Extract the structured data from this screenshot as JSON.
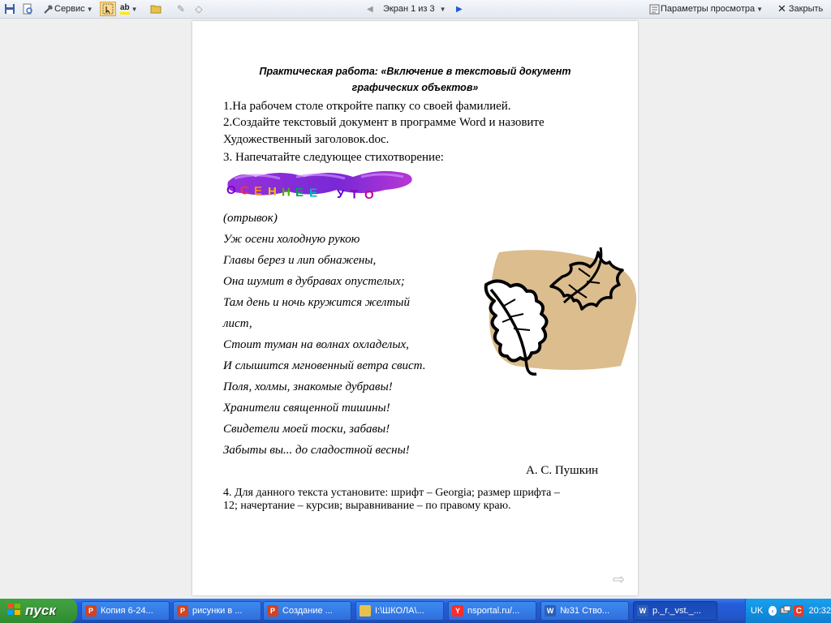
{
  "toolbar": {
    "service_label": "Сервис",
    "screen_label": "Экран 1 из 3",
    "view_params_label": "Параметры просмотра",
    "close_label": "Закрыть",
    "highlight_glyph": "ab"
  },
  "document": {
    "title_line1": "Практическая работа: «Включение в текстовый документ",
    "title_line2": "графических объектов»",
    "step1": "1.На рабочем столе откройте папку со своей фамилией.",
    "step2_line1": "2.Создайте текстовый документ в программе Word и назовите",
    "step2_line2": "Художественный заголовок.doc.",
    "step3": "3. Напечатайте следующее стихотворение:",
    "wordart_letters": [
      "О",
      "С",
      "Е",
      "Н",
      "Н",
      "Е",
      "Е",
      "",
      "У",
      "Т",
      "О"
    ],
    "wordart_colors": [
      "#7a00c8",
      "#ff3030",
      "#ff8c00",
      "#f2c200",
      "#4fb000",
      "#00a060",
      "#00b0c8",
      "#1060ff",
      "#5a00d8",
      "#8000c0",
      "#c000a0"
    ],
    "excerpt": "(отрывок)",
    "poem": [
      "Уж осени холодную рукою",
      "Главы берез и лип обнажены,",
      "Она шумит в дубравах опустелых;",
      "Там день и ночь кружится желтый",
      "лист,",
      "Стоит туман на волнах охладелых,",
      "И слышится мгновенный ветра свист.",
      "Поля, холмы, знакомые дубравы!",
      "Хранители священной тишины!",
      "Свидетели моей тоски, забавы!",
      "Забыты вы... до сладостной весны!"
    ],
    "author": "А. С. Пушкин",
    "step4_line1": "4. Для данного текста установите: шрифт – Georgia; размер шрифта –",
    "step4_line2": "12; начертание – курсив;  выравнивание – по правому краю."
  },
  "taskbar": {
    "start_label": "пуск",
    "tasks": [
      {
        "label": "Копия 6-24...",
        "icon": "powerpoint-icon",
        "color": "#d2431f"
      },
      {
        "label": "рисунки в ...",
        "icon": "powerpoint-icon",
        "color": "#d2431f"
      },
      {
        "label": "Создание ...",
        "icon": "powerpoint-icon",
        "color": "#d2431f"
      },
      {
        "label": "I:\\ШКОЛА\\...",
        "icon": "folder-icon",
        "color": "#e8c24a"
      },
      {
        "label": "nsportal.ru/...",
        "icon": "yandex-browser-icon",
        "color": "#ff2b2b"
      },
      {
        "label": "№31 Ство...",
        "icon": "word-icon",
        "color": "#2b5fb8"
      },
      {
        "label": "р._r._vst._...",
        "icon": "word-icon",
        "color": "#2b5fb8"
      }
    ],
    "language": "UK",
    "clock": "20:32"
  },
  "colors": {
    "leaf_background": "#dcbd8e",
    "taskbar_blue": "#245edb",
    "start_green": "#3c9a3c"
  }
}
